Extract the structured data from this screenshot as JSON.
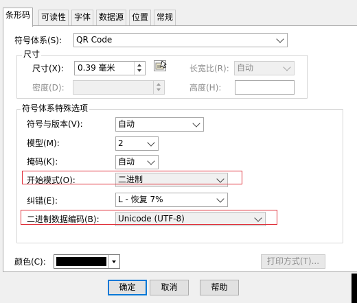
{
  "tabs": [
    {
      "label": "条形码",
      "active": true
    },
    {
      "label": "可读性",
      "active": false
    },
    {
      "label": "字体",
      "active": false
    },
    {
      "label": "数据源",
      "active": false
    },
    {
      "label": "位置",
      "active": false
    },
    {
      "label": "常规",
      "active": false
    }
  ],
  "symbology": {
    "label": "符号体系(S):",
    "value": "QR Code"
  },
  "size_group": {
    "title": "尺寸",
    "size_label": "尺寸(X):",
    "size_value": "0.39 毫米",
    "density_label": "密度(D):",
    "density_value": "",
    "aspect_label": "长宽比(R):",
    "aspect_value": "自动",
    "height_label": "高度(H):",
    "height_value": ""
  },
  "options_group": {
    "title": "符号体系特殊选项",
    "version": {
      "label": "符号与版本(V):",
      "value": "自动"
    },
    "model": {
      "label": "模型(M):",
      "value": "2"
    },
    "mask": {
      "label": "掩码(K):",
      "value": "自动"
    },
    "start_mode": {
      "label": "开始模式(O):",
      "value": "二进制"
    },
    "error_correction": {
      "label": "纠错(E):",
      "value": "L - 恢复 7%"
    },
    "binary_encoding": {
      "label": "二进制数据编码(B):",
      "value": "Unicode (UTF-8)"
    }
  },
  "color": {
    "label": "颜色(C):",
    "swatch": "#000000"
  },
  "print_method_button": "打印方式(T)...",
  "footer": {
    "ok": "确定",
    "cancel": "取消",
    "help": "帮助"
  },
  "colors": {
    "highlight_box": "#e0303a",
    "default_button_border": "#0078d7"
  }
}
